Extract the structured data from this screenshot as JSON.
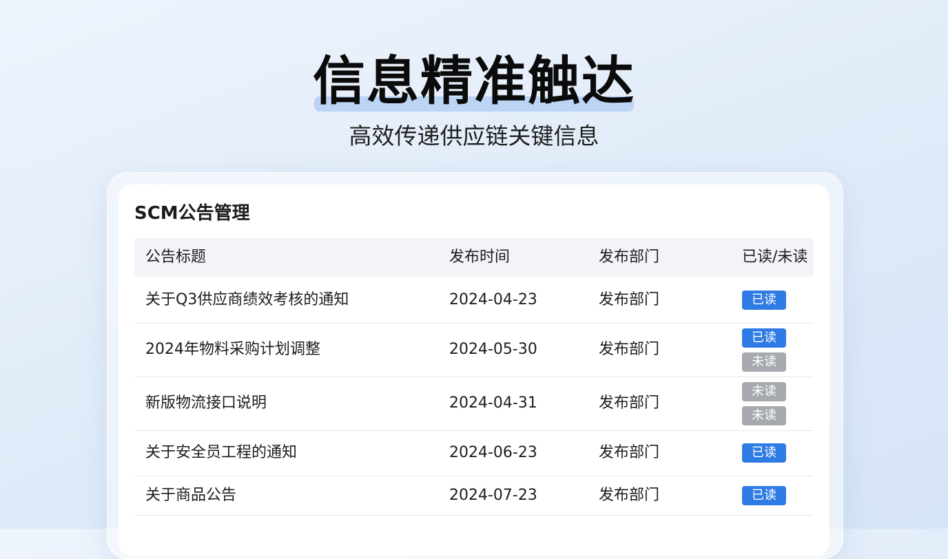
{
  "hero": {
    "title": "信息精准触达",
    "subtitle": "高效传递供应链关键信息"
  },
  "panel": {
    "title": "SCM公告管理",
    "columns": {
      "title": "公告标题",
      "date": "发布时间",
      "dept": "发布部门",
      "status": "已读/未读"
    },
    "rows": [
      {
        "title": "关于Q3供应商绩效考核的通知",
        "date": "2024-04-23",
        "dept": "发布部门",
        "badges": [
          {
            "label": "已读",
            "state": "read"
          }
        ]
      },
      {
        "title": "2024年物料采购计划调整",
        "date": "2024-05-30",
        "dept": "发布部门",
        "badges": [
          {
            "label": "已读",
            "state": "read"
          },
          {
            "label": "未读",
            "state": "unread"
          }
        ]
      },
      {
        "title": "新版物流接口说明",
        "date": "2024-04-31",
        "dept": "发布部门",
        "badges": [
          {
            "label": "未读",
            "state": "unread"
          },
          {
            "label": "未读",
            "state": "unread"
          }
        ]
      },
      {
        "title": "关于安全员工程的通知",
        "date": "2024-06-23",
        "dept": "发布部门",
        "badges": [
          {
            "label": "已读",
            "state": "read"
          }
        ]
      },
      {
        "title": "关于商品公告",
        "date": "2024-07-23",
        "dept": "发布部门",
        "badges": [
          {
            "label": "已读",
            "state": "read"
          }
        ]
      }
    ]
  },
  "colors": {
    "read_badge": "#2f7be5",
    "unread_badge": "#a6a9ad",
    "title_highlight": "#b7d1f4"
  }
}
